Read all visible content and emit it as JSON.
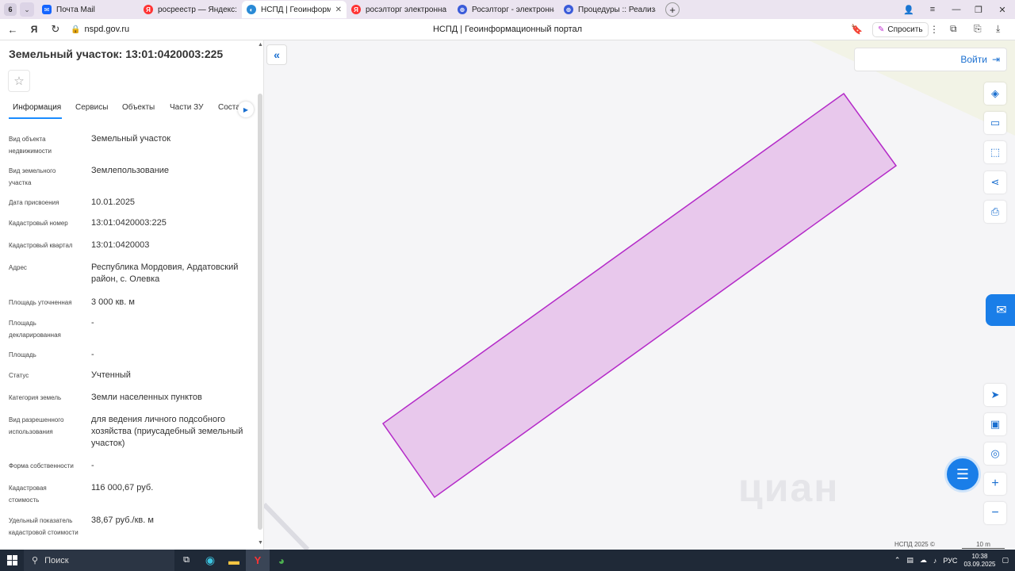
{
  "browser": {
    "tab_count": "6",
    "tabs": [
      {
        "title": "Почта Mail",
        "icon": "mail-icon"
      },
      {
        "title": "росреестр — Яндекс: нашлось",
        "icon": "yandex-icon"
      },
      {
        "title": "НСПД | Геоинформаци",
        "icon": "nspd-icon"
      },
      {
        "title": "росэлторг электронная п",
        "icon": "yandex-icon"
      },
      {
        "title": "Росэлторг - электронная",
        "icon": "roseltorg-icon"
      },
      {
        "title": "Процедуры :: Реализация",
        "icon": "roseltorg-icon"
      }
    ],
    "url": "nspd.gov.ru",
    "page_title": "НСПД | Геоинформационный портал",
    "ask_label": "Спросить"
  },
  "panel": {
    "title": "Земельный участок: 13:01:0420003:225",
    "tabs": [
      "Информация",
      "Сервисы",
      "Объекты",
      "Части ЗУ",
      "Соста"
    ],
    "fields": [
      {
        "label": "Вид объекта недвижимости",
        "value": "Земельный участок"
      },
      {
        "label": "Вид земельного участка",
        "value": "Землепользование"
      },
      {
        "label": "Дата присвоения",
        "value": "10.01.2025"
      },
      {
        "label": "Кадастровый номер",
        "value": "13:01:0420003:225"
      },
      {
        "label": "Кадастровый квартал",
        "value": "13:01:0420003"
      },
      {
        "label": "Адрес",
        "value": "Республика Мордовия, Ардатовский район, с. Олевка"
      },
      {
        "label": "Площадь уточненная",
        "value": "3 000 кв. м"
      },
      {
        "label": "Площадь декларированная",
        "value": "-"
      },
      {
        "label": "Площадь",
        "value": "-"
      },
      {
        "label": "Статус",
        "value": "Учтенный"
      },
      {
        "label": "Категория земель",
        "value": "Земли населенных пунктов"
      },
      {
        "label": "Вид разрешенного использования",
        "value": "для ведения личного подсобного хозяйства (приусадебный земельный участок)"
      },
      {
        "label": "Форма собственности",
        "value": "-"
      },
      {
        "label": "Кадастровая стоимость",
        "value": "116 000,67 руб."
      },
      {
        "label": "Удельный показатель кадастровой стоимости",
        "value": "38,67 руб./кв. м"
      }
    ]
  },
  "map": {
    "login_label": "Войти",
    "copyright": "НСПД 2025 ©",
    "scale_label": "10 m",
    "watermark": "циан",
    "parcel_fill": "#e8c8ec",
    "parcel_stroke": "#b42ac8"
  },
  "taskbar": {
    "search_label": "Поиск",
    "lang": "РУС",
    "time": "10:38",
    "date": "03.09.2025"
  }
}
